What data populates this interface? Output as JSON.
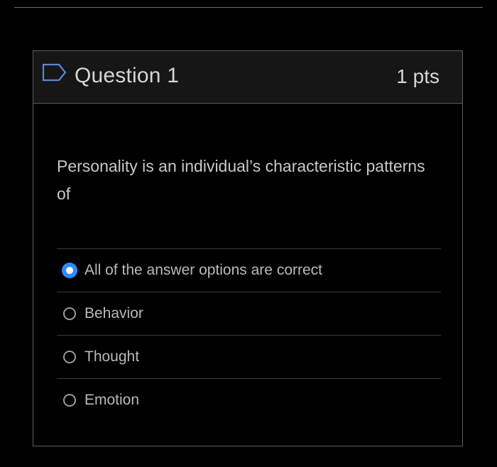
{
  "question": {
    "title": "Question 1",
    "points": "1 pts",
    "text": "Personality is an individual’s characteristic patterns of",
    "flag_icon": "flag-outline-icon"
  },
  "answers": [
    {
      "label": "All of the answer options are correct",
      "selected": true
    },
    {
      "label": "Behavior",
      "selected": false
    },
    {
      "label": "Thought",
      "selected": false
    },
    {
      "label": "Emotion",
      "selected": false
    }
  ],
  "colors": {
    "accent": "#2f8cff",
    "background": "#000000",
    "header_background": "#161616",
    "border": "#5f5f5f"
  }
}
